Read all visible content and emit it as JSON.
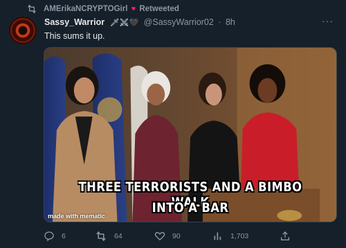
{
  "retweet_bar": {
    "retweeter": "AMErikaNCRYPTOGirl",
    "heart": "♥",
    "label": "Retweeted"
  },
  "tweet": {
    "display_name": "Sassy_Warrior",
    "name_emojis": "🗡⚔🖤",
    "handle": "@SassyWarrior02",
    "separator": "·",
    "time": "8h",
    "more": "···",
    "text": "This sums it up."
  },
  "media": {
    "caption_line1": "THREE TERRORISTS AND A BIMBO WALK",
    "caption_line2": "INTO A BAR",
    "watermark": "made with mematic"
  },
  "actions": {
    "replies": "6",
    "retweets": "64",
    "likes": "90",
    "views": "1,703"
  },
  "colors": {
    "background": "#15202b",
    "secondary_text": "#8b98a5",
    "like_red": "#f91880"
  },
  "icons": [
    "retweet-icon",
    "more-icon",
    "reply-icon",
    "like-icon",
    "views-icon",
    "share-icon"
  ]
}
